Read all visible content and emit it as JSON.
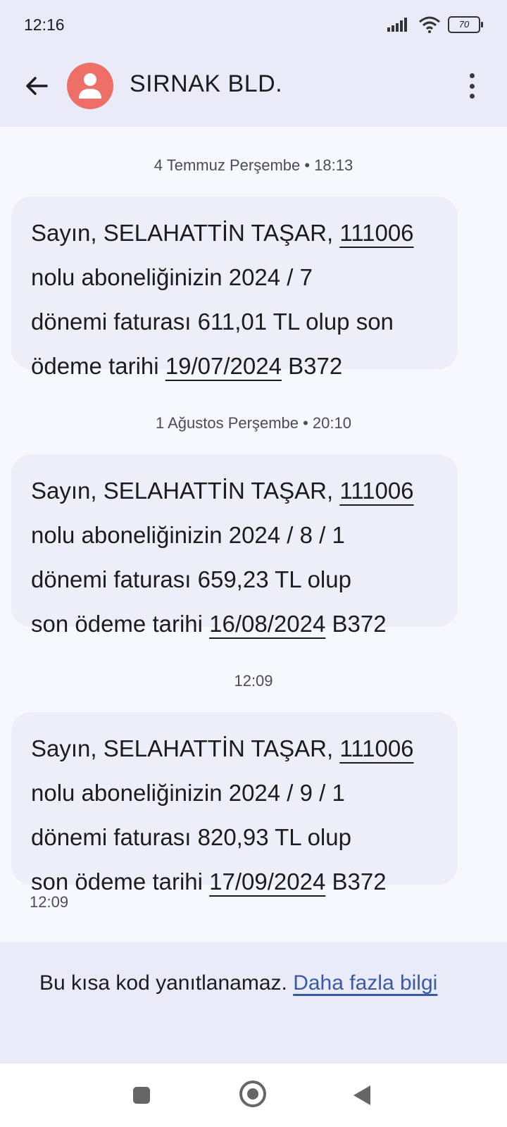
{
  "status": {
    "time": "12:16",
    "battery": "70"
  },
  "header": {
    "contact": "SIRNAK BLD.",
    "avatar_color": "#ee6f68"
  },
  "messages": [
    {
      "date": "4 Temmuz Perşembe • 18:13",
      "l1a": "Sayın, SELAHATTİN TAŞAR, ",
      "l1b": "111006",
      "l2": "nolu aboneliğinizin 2024 / 7",
      "l3": "dönemi faturası 611,01 TL olup son",
      "l4a": "ödeme tarihi ",
      "l4b": "19/07/2024",
      "l4c": " B372"
    },
    {
      "date": "1 Ağustos Perşembe • 20:10",
      "l1a": "Sayın, SELAHATTİN TAŞAR, ",
      "l1b": "111006",
      "l2": "nolu aboneliğinizin 2024 / 8 / 1",
      "l3": "dönemi faturası 659,23 TL olup",
      "l4a": "son ödeme tarihi ",
      "l4b": "16/08/2024",
      "l4c": " B372"
    },
    {
      "date": "12:09",
      "l1a": "Sayın, SELAHATTİN TAŞAR, ",
      "l1b": "111006",
      "l2": "nolu aboneliğinizin 2024 / 9 / 1",
      "l3": "dönemi faturası 820,93 TL olup",
      "l4a": "son ödeme tarihi ",
      "l4b": "17/09/2024",
      "l4c": " B372",
      "time": "12:09"
    }
  ],
  "footer": {
    "text": "Bu kısa kod yanıtlanamaz. ",
    "link": "Daha fazla bilgi"
  }
}
